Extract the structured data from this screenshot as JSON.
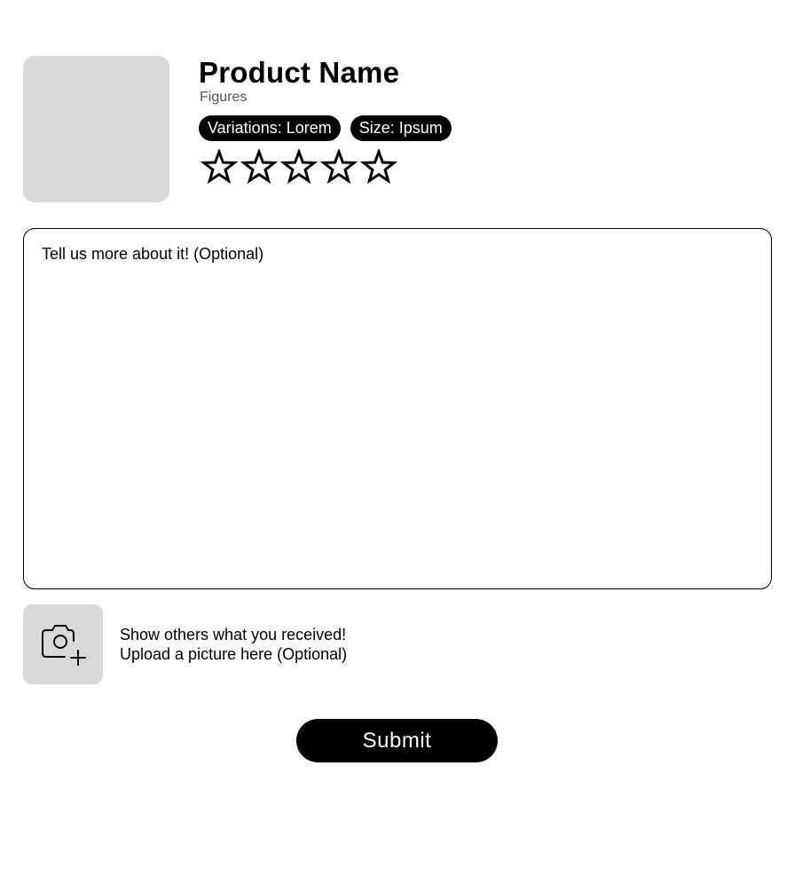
{
  "product": {
    "name": "Product Name",
    "category": "Figures",
    "chips": [
      "Variations: Lorem",
      "Size: Ipsum"
    ]
  },
  "rating": {
    "max_stars": 5,
    "selected": 0,
    "star_icon": "star-outline-icon"
  },
  "review": {
    "placeholder": "Tell us more about it! (Optional)",
    "value": ""
  },
  "upload": {
    "icon": "camera-plus-icon",
    "line1": "Show others what you received!",
    "line2": "Upload a picture here (Optional)"
  },
  "submit": {
    "label": "Submit"
  },
  "colors": {
    "accent": "#000000",
    "placeholder_bg": "#d9d9d9",
    "background": "#ffffff"
  }
}
